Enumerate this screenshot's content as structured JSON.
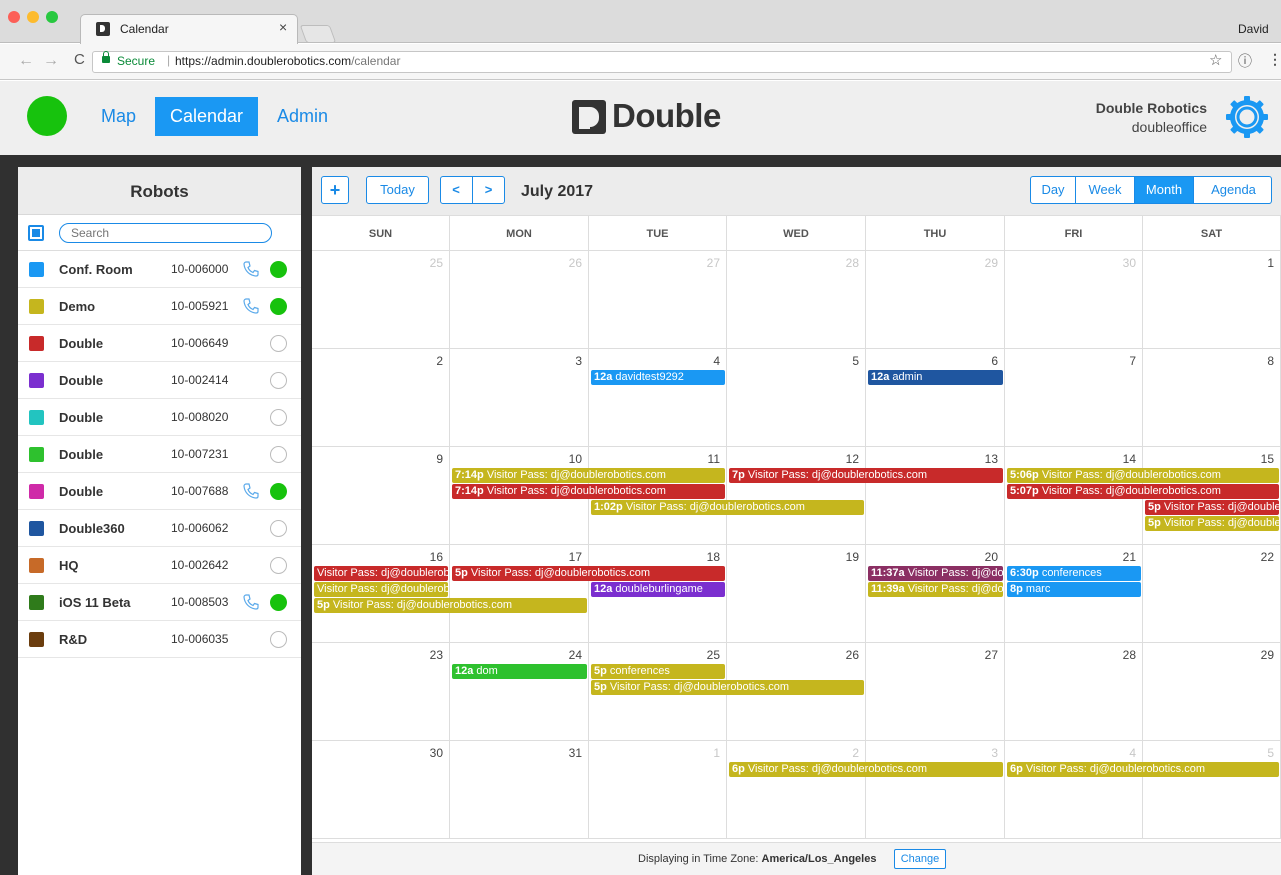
{
  "browser": {
    "tab_title": "Calendar",
    "tab_close": "×",
    "user": "David",
    "secure_label": "Secure",
    "url_host": "https://admin.doublerobotics.com",
    "url_path": "/calendar"
  },
  "app": {
    "nav": [
      "Map",
      "Calendar",
      "Admin"
    ],
    "active_nav": "Calendar",
    "brand": "Double",
    "org_name": "Double Robotics",
    "org_sub": "doubleoffice",
    "status_color": "#17c20d",
    "accent": "#1a98f3"
  },
  "sidebar": {
    "title": "Robots",
    "search_placeholder": "Search",
    "robots": [
      {
        "name": "Conf. Room",
        "id": "10-006000",
        "color": "#1a98f3",
        "phone": true,
        "online": true
      },
      {
        "name": "Demo",
        "id": "10-005921",
        "color": "#c5b61e",
        "phone": true,
        "online": true
      },
      {
        "name": "Double",
        "id": "10-006649",
        "color": "#c82a2a",
        "phone": false,
        "online": false
      },
      {
        "name": "Double",
        "id": "10-002414",
        "color": "#7b2fcf",
        "phone": false,
        "online": false
      },
      {
        "name": "Double",
        "id": "10-008020",
        "color": "#22c4c0",
        "phone": false,
        "online": false
      },
      {
        "name": "Double",
        "id": "10-007231",
        "color": "#2ec12e",
        "phone": false,
        "online": false
      },
      {
        "name": "Double",
        "id": "10-007688",
        "color": "#cf2aa8",
        "phone": true,
        "online": true
      },
      {
        "name": "Double360",
        "id": "10-006062",
        "color": "#1f56a0",
        "phone": false,
        "online": false
      },
      {
        "name": "HQ",
        "id": "10-002642",
        "color": "#c76a28",
        "phone": false,
        "online": false
      },
      {
        "name": "iOS 11 Beta",
        "id": "10-008503",
        "color": "#2f7b1b",
        "phone": true,
        "online": true
      },
      {
        "name": "R&D",
        "id": "10-006035",
        "color": "#6b3d0e",
        "phone": false,
        "online": false
      }
    ]
  },
  "calendar": {
    "add_label": "+",
    "today_label": "Today",
    "prev_label": "<",
    "next_label": ">",
    "month_title": "July 2017",
    "views": [
      "Day",
      "Week",
      "Month",
      "Agenda"
    ],
    "active_view": "Month",
    "weekdays": [
      "SUN",
      "MON",
      "TUE",
      "WED",
      "THU",
      "FRI",
      "SAT"
    ],
    "weeks": [
      [
        {
          "d": "25",
          "other": true
        },
        {
          "d": "26",
          "other": true
        },
        {
          "d": "27",
          "other": true
        },
        {
          "d": "28",
          "other": true
        },
        {
          "d": "29",
          "other": true
        },
        {
          "d": "30",
          "other": true
        },
        {
          "d": "1"
        }
      ],
      [
        {
          "d": "2"
        },
        {
          "d": "3"
        },
        {
          "d": "4"
        },
        {
          "d": "5"
        },
        {
          "d": "6"
        },
        {
          "d": "7"
        },
        {
          "d": "8"
        }
      ],
      [
        {
          "d": "9"
        },
        {
          "d": "10"
        },
        {
          "d": "11"
        },
        {
          "d": "12"
        },
        {
          "d": "13"
        },
        {
          "d": "14"
        },
        {
          "d": "15"
        }
      ],
      [
        {
          "d": "16"
        },
        {
          "d": "17"
        },
        {
          "d": "18"
        },
        {
          "d": "19"
        },
        {
          "d": "20"
        },
        {
          "d": "21"
        },
        {
          "d": "22"
        }
      ],
      [
        {
          "d": "23"
        },
        {
          "d": "24"
        },
        {
          "d": "25"
        },
        {
          "d": "26"
        },
        {
          "d": "27"
        },
        {
          "d": "28"
        },
        {
          "d": "29"
        }
      ],
      [
        {
          "d": "30"
        },
        {
          "d": "31"
        },
        {
          "d": "1",
          "other": true
        },
        {
          "d": "2",
          "other": true
        },
        {
          "d": "3",
          "other": true
        },
        {
          "d": "4",
          "other": true
        },
        {
          "d": "5",
          "other": true
        }
      ]
    ],
    "events": [
      {
        "week": 1,
        "day": 2,
        "span": 1,
        "slot": 0,
        "time": "12a",
        "title": "davidtest9292",
        "color": "#1a98f3"
      },
      {
        "week": 1,
        "day": 4,
        "span": 1,
        "slot": 0,
        "time": "12a",
        "title": "admin",
        "color": "#1f56a0"
      },
      {
        "week": 2,
        "day": 1,
        "span": 2,
        "slot": 0,
        "time": "7:14p",
        "title": "Visitor Pass: dj@doublerobotics.com",
        "color": "#c5b61e"
      },
      {
        "week": 2,
        "day": 1,
        "span": 2,
        "slot": 1,
        "time": "7:14p",
        "title": "Visitor Pass: dj@doublerobotics.com",
        "color": "#c82a2a"
      },
      {
        "week": 2,
        "day": 2,
        "span": 2,
        "slot": 2,
        "time": "1:02p",
        "title": "Visitor Pass: dj@doublerobotics.com",
        "color": "#c5b61e"
      },
      {
        "week": 2,
        "day": 3,
        "span": 2,
        "slot": 0,
        "time": "7p",
        "title": "Visitor Pass: dj@doublerobotics.com",
        "color": "#c82a2a"
      },
      {
        "week": 2,
        "day": 5,
        "span": 2,
        "slot": 0,
        "time": "5:06p",
        "title": "Visitor Pass: dj@doublerobotics.com",
        "color": "#c5b61e"
      },
      {
        "week": 2,
        "day": 5,
        "span": 2,
        "slot": 1,
        "time": "5:07p",
        "title": "Visitor Pass: dj@doublerobotics.com",
        "color": "#c82a2a"
      },
      {
        "week": 2,
        "day": 6,
        "span": 1,
        "slot": 2,
        "time": "5p",
        "title": "Visitor Pass: dj@doublerobotics.com",
        "color": "#c82a2a"
      },
      {
        "week": 2,
        "day": 6,
        "span": 1,
        "slot": 3,
        "time": "5p",
        "title": "Visitor Pass: dj@doublerobotics.com",
        "color": "#c5b61e"
      },
      {
        "week": 3,
        "day": 0,
        "span": 1,
        "slot": 0,
        "time": "",
        "title": "Visitor Pass: dj@doublerobotics.com",
        "color": "#c82a2a"
      },
      {
        "week": 3,
        "day": 0,
        "span": 1,
        "slot": 1,
        "time": "",
        "title": "Visitor Pass: dj@doublerobotics.com",
        "color": "#c5b61e"
      },
      {
        "week": 3,
        "day": 0,
        "span": 2,
        "slot": 2,
        "time": "5p",
        "title": "Visitor Pass: dj@doublerobotics.com",
        "color": "#c5b61e"
      },
      {
        "week": 3,
        "day": 1,
        "span": 2,
        "slot": 0,
        "time": "5p",
        "title": "Visitor Pass: dj@doublerobotics.com",
        "color": "#c82a2a"
      },
      {
        "week": 3,
        "day": 2,
        "span": 1,
        "slot": 1,
        "time": "12a",
        "title": "doubleburlingame",
        "color": "#7b2fcf"
      },
      {
        "week": 3,
        "day": 4,
        "span": 1,
        "slot": 0,
        "time": "11:37a",
        "title": "Visitor Pass: dj@doublerobotics.com",
        "color": "#8b2f63"
      },
      {
        "week": 3,
        "day": 4,
        "span": 1,
        "slot": 1,
        "time": "11:39a",
        "title": "Visitor Pass: dj@doublerobotics.com",
        "color": "#c5b61e"
      },
      {
        "week": 3,
        "day": 5,
        "span": 1,
        "slot": 0,
        "time": "6:30p",
        "title": "conferences",
        "color": "#1a98f3"
      },
      {
        "week": 3,
        "day": 5,
        "span": 1,
        "slot": 1,
        "time": "8p",
        "title": "marc",
        "color": "#1a98f3"
      },
      {
        "week": 4,
        "day": 1,
        "span": 1,
        "slot": 0,
        "time": "12a",
        "title": "dom",
        "color": "#2ec12e"
      },
      {
        "week": 4,
        "day": 2,
        "span": 1,
        "slot": 0,
        "time": "5p",
        "title": "conferences",
        "color": "#c5b61e"
      },
      {
        "week": 4,
        "day": 2,
        "span": 2,
        "slot": 1,
        "time": "5p",
        "title": "Visitor Pass: dj@doublerobotics.com",
        "color": "#c5b61e"
      },
      {
        "week": 5,
        "day": 3,
        "span": 2,
        "slot": 0,
        "time": "6p",
        "title": "Visitor Pass: dj@doublerobotics.com",
        "color": "#c5b61e"
      },
      {
        "week": 5,
        "day": 5,
        "span": 2,
        "slot": 0,
        "time": "6p",
        "title": "Visitor Pass: dj@doublerobotics.com",
        "color": "#c5b61e"
      }
    ],
    "tz_prefix": "Displaying in Time Zone:",
    "tz_value": "America/Los_Angeles",
    "tz_change": "Change"
  }
}
